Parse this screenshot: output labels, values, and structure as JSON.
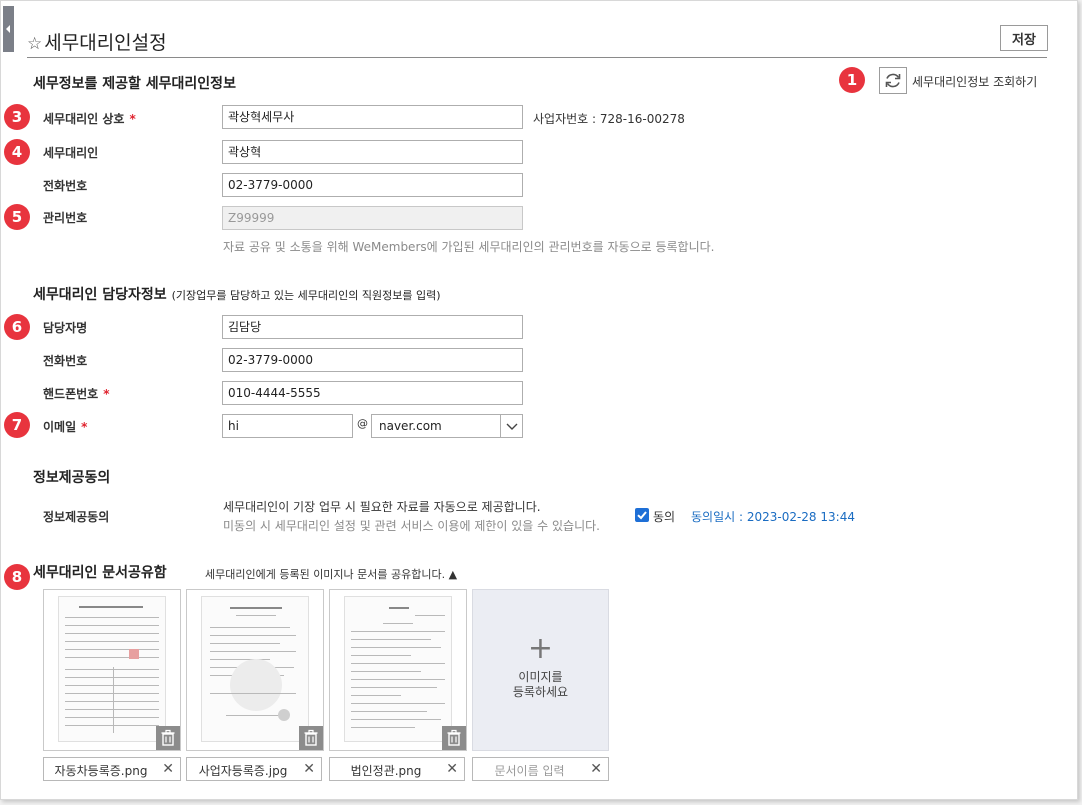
{
  "header": {
    "title": "세무대리인설정",
    "save_label": "저장"
  },
  "agent_info": {
    "section_title": "세무정보를 제공할 세무대리인정보",
    "lookup_label": "세무대리인정보 조회하기",
    "fields": {
      "trade_name": {
        "label": "세무대리인 상호",
        "value": "곽상혁세무사",
        "required": "*"
      },
      "agent_name": {
        "label": "세무대리인",
        "value": "곽상혁"
      },
      "phone": {
        "label": "전화번호",
        "value": "02-3779-0000"
      },
      "mgmt_no": {
        "label": "관리번호",
        "value": "Z99999"
      }
    },
    "biz_no_text": "사업자번호 : 728-16-00278",
    "mgmt_hint": "자료 공유 및 소통을 위해 WeMembers에 가입된 세무대리인의 관리번호를 자동으로 등록합니다."
  },
  "contact_info": {
    "section_title": "세무대리인 담당자정보",
    "section_sub": "(기장업무를 담당하고 있는 세무대리인의 직원정보를 입력)",
    "fields": {
      "name": {
        "label": "담당자명",
        "value": "김담당"
      },
      "phone": {
        "label": "전화번호",
        "value": "02-3779-0000"
      },
      "mobile": {
        "label": "핸드폰번호",
        "value": "010-4444-5555",
        "required": "*"
      },
      "email": {
        "label": "이메일",
        "required": "*",
        "local": "hi",
        "at": "@",
        "domain": "naver.com"
      }
    }
  },
  "consent": {
    "section_title": "정보제공동의",
    "label": "정보제공동의",
    "line1": "세무대리인이 기장 업무 시 필요한 자료를 자동으로 제공합니다.",
    "line2": "미동의 시 세무대리인 설정 및 관련 서비스 이용에 제한이 있을 수 있습니다.",
    "checkbox_label": "동의",
    "checked": true,
    "date_text": "동의일시 : 2023-02-28 13:44"
  },
  "docs": {
    "section_title": "세무대리인 문서공유함",
    "section_sub": "세무대리인에게 등록된 이미지나 문서를 공유합니다.",
    "toggle_glyph": "▲",
    "files": [
      {
        "name": "자동차등록증.png"
      },
      {
        "name": "사업자등록증.jpg"
      },
      {
        "name": "법인정관.png"
      }
    ],
    "add_label": "이미지를\n등록하세요",
    "add_glyph": "+",
    "name_placeholder": "문서이름 입력"
  },
  "badges": [
    "1",
    "3",
    "4",
    "5",
    "6",
    "7",
    "8"
  ],
  "colors": {
    "badge": "#e8343e",
    "required": "#e0232e",
    "link": "#1a6cc2",
    "check": "#1e6fd6"
  },
  "icons": {
    "star": "star-icon",
    "refresh": "refresh-icon",
    "trash": "trash-icon",
    "close": "close-icon",
    "chevron": "chevron-down-icon"
  }
}
